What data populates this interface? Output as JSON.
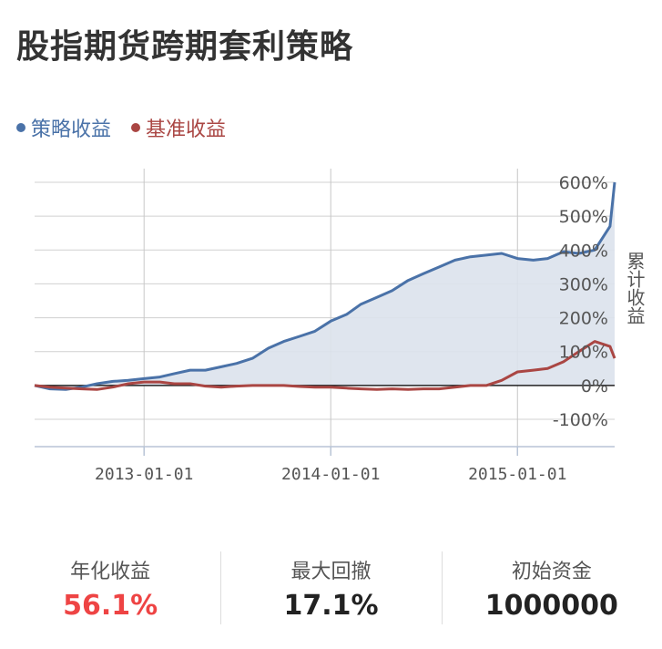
{
  "title": "股指期货跨期套利策略",
  "colors": {
    "strategy": "#4a72a8",
    "benchmark": "#aa4643",
    "fill": "#dbe2ec",
    "negative_value": "#ee4444"
  },
  "chart_data": {
    "type": "area",
    "legend": [
      "策略收益",
      "基准收益"
    ],
    "legend_position": "top-left",
    "ylabel": "累计收益",
    "y_axis_position": "right",
    "ylim": [
      -100,
      600
    ],
    "yticks": [
      "600%",
      "500%",
      "400%",
      "300%",
      "200%",
      "100%",
      "0%",
      "-100%"
    ],
    "ytick_values": [
      600,
      500,
      400,
      300,
      200,
      100,
      0,
      -100
    ],
    "xlim": [
      "2012-06-01",
      "2015-07-10"
    ],
    "xticks": [
      "2013-01-01",
      "2014-01-01",
      "2015-01-01"
    ],
    "grid": true,
    "series": [
      {
        "name": "策略收益",
        "x": [
          "2012-06-01",
          "2012-07-01",
          "2012-08-01",
          "2012-09-01",
          "2012-10-01",
          "2012-11-01",
          "2012-12-01",
          "2013-01-01",
          "2013-02-01",
          "2013-03-01",
          "2013-04-01",
          "2013-05-01",
          "2013-06-01",
          "2013-07-01",
          "2013-08-01",
          "2013-09-01",
          "2013-10-01",
          "2013-11-01",
          "2013-12-01",
          "2014-01-01",
          "2014-02-01",
          "2014-03-01",
          "2014-04-01",
          "2014-05-01",
          "2014-06-01",
          "2014-07-01",
          "2014-08-01",
          "2014-09-01",
          "2014-10-01",
          "2014-11-01",
          "2014-12-01",
          "2015-01-01",
          "2015-02-01",
          "2015-03-01",
          "2015-04-01",
          "2015-05-01",
          "2015-06-01",
          "2015-07-01",
          "2015-07-10"
        ],
        "values": [
          0,
          -10,
          -12,
          -5,
          5,
          12,
          15,
          20,
          25,
          35,
          45,
          45,
          55,
          65,
          80,
          110,
          130,
          145,
          160,
          190,
          210,
          240,
          260,
          280,
          310,
          330,
          350,
          370,
          380,
          385,
          390,
          375,
          370,
          375,
          395,
          390,
          400,
          470,
          600
        ]
      },
      {
        "name": "基准收益",
        "x": [
          "2012-06-01",
          "2012-07-01",
          "2012-08-01",
          "2012-09-01",
          "2012-10-01",
          "2012-11-01",
          "2012-12-01",
          "2013-01-01",
          "2013-02-01",
          "2013-03-01",
          "2013-04-01",
          "2013-05-01",
          "2013-06-01",
          "2013-07-01",
          "2013-08-01",
          "2013-09-01",
          "2013-10-01",
          "2013-11-01",
          "2013-12-01",
          "2014-01-01",
          "2014-02-01",
          "2014-03-01",
          "2014-04-01",
          "2014-05-01",
          "2014-06-01",
          "2014-07-01",
          "2014-08-01",
          "2014-09-01",
          "2014-10-01",
          "2014-11-01",
          "2014-12-01",
          "2015-01-01",
          "2015-02-01",
          "2015-03-01",
          "2015-04-01",
          "2015-05-01",
          "2015-06-01",
          "2015-07-01",
          "2015-07-10"
        ],
        "values": [
          0,
          -5,
          -8,
          -10,
          -12,
          -5,
          5,
          10,
          10,
          5,
          5,
          -2,
          -5,
          -2,
          0,
          0,
          0,
          -3,
          -5,
          -5,
          -8,
          -10,
          -12,
          -10,
          -12,
          -10,
          -10,
          -5,
          0,
          0,
          15,
          40,
          45,
          50,
          70,
          100,
          130,
          115,
          80
        ]
      }
    ]
  },
  "stats": [
    {
      "label": "年化收益",
      "value": "56.1%"
    },
    {
      "label": "最大回撤",
      "value": "17.1%"
    },
    {
      "label": "初始资金",
      "value": "1000000"
    }
  ]
}
